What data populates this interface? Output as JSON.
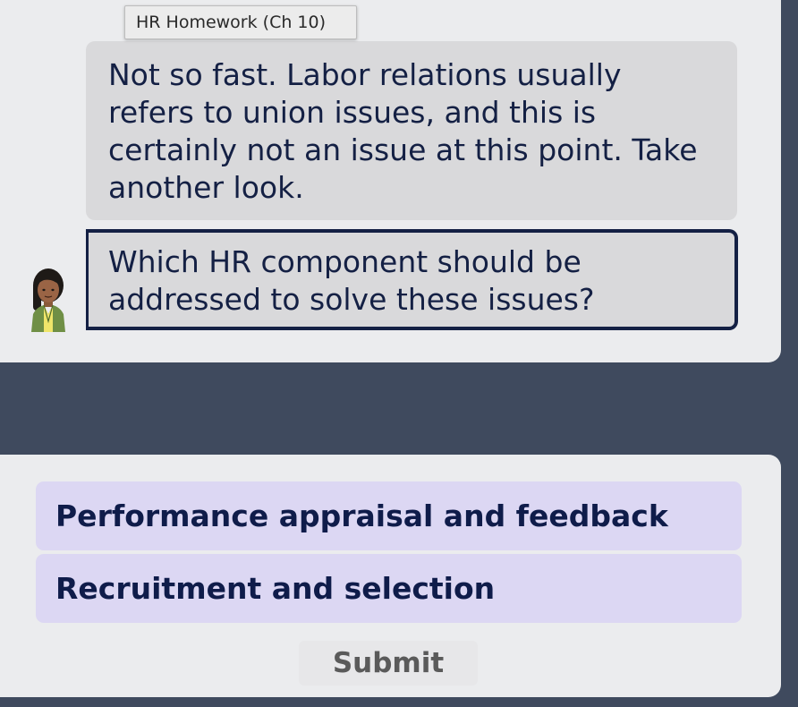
{
  "tooltip": {
    "text": "HR Homework (Ch 10)"
  },
  "chat": {
    "feedback": "Not so fast. Labor relations usually refers to union issues, and this is certainly not an issue at this point. Take another look.",
    "question": "Which HR component should be addressed to solve these issues?",
    "avatar_icon": "female-advisor-avatar"
  },
  "answers": {
    "options": [
      {
        "label": "Performance appraisal and feedback"
      },
      {
        "label": "Recruitment and selection"
      }
    ],
    "submit_label": "Submit"
  },
  "colors": {
    "background": "#3f4a5e",
    "panel": "#ebecee",
    "bubble": "#d9d9db",
    "text_navy": "#142044",
    "option_bg": "#dcd7f3"
  }
}
